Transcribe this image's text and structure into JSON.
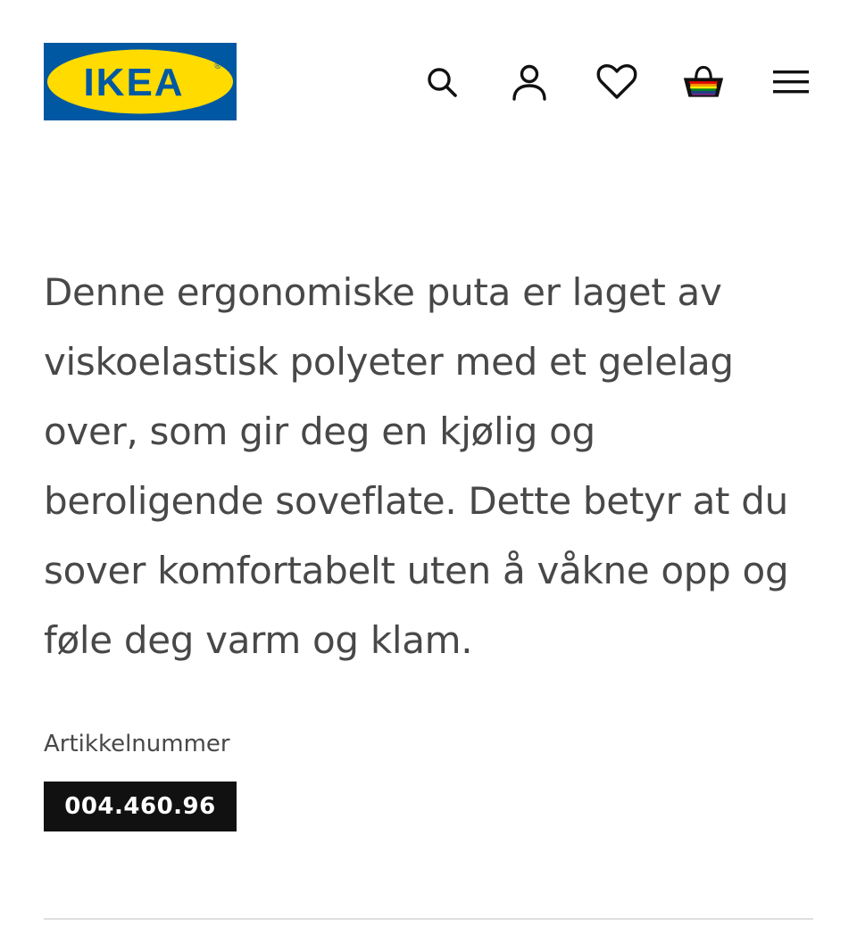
{
  "header": {
    "logo_text": "IKEA",
    "logo_mark": "®",
    "brand_colors": {
      "blue": "#0058A3",
      "yellow": "#FFDB00"
    },
    "icons": [
      "search-icon",
      "profile-icon",
      "heart-icon",
      "shopping-bag-icon",
      "hamburger-menu-icon"
    ]
  },
  "product": {
    "description": "Denne ergonomiske puta er laget av viskoelastisk polyeter med et gelelag over, som gir deg en kjølig og beroligende soveflate. Dette betyr at du sover komfortabelt uten å våkne opp og føle deg varm og klam.",
    "article_label": "Artikkelnummer",
    "article_number": "004.460.96"
  }
}
